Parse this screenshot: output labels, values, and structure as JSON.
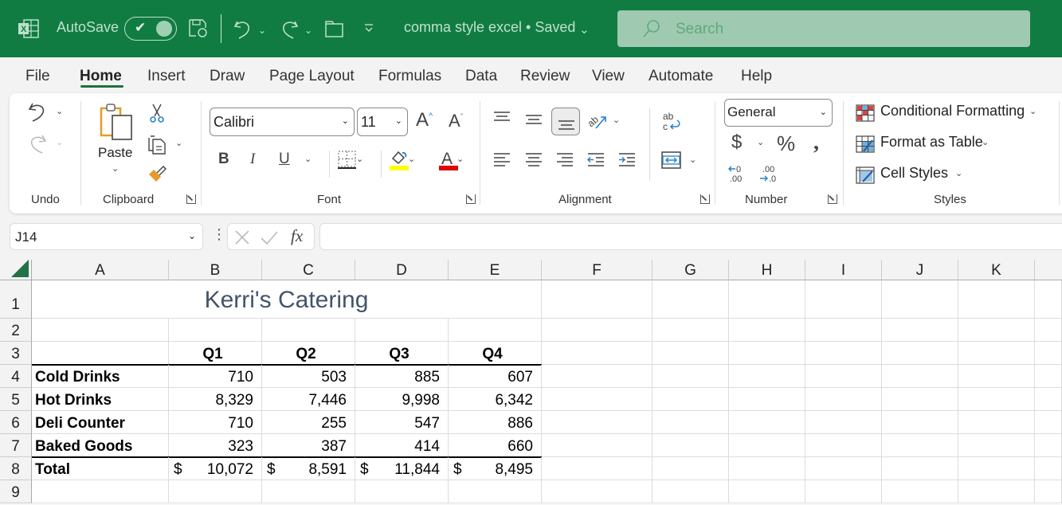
{
  "titlebar": {
    "app_icon": "excel-icon",
    "autosave_label": "AutoSave",
    "autosave_on": true,
    "save_icon": "save-icon",
    "undo_icon": "undo-icon",
    "redo_icon": "redo-icon",
    "open_icon": "folder-icon",
    "customize_icon": "customize-quick-access-icon",
    "document_title": "comma style excel • Saved",
    "search_placeholder": "Search"
  },
  "menu": {
    "tabs": [
      "File",
      "Home",
      "Insert",
      "Draw",
      "Page Layout",
      "Formulas",
      "Data",
      "Review",
      "View",
      "Automate",
      "Help"
    ],
    "active": "Home"
  },
  "ribbon": {
    "groups": {
      "undo": "Undo",
      "clipboard": "Clipboard",
      "font": "Font",
      "alignment": "Alignment",
      "number": "Number",
      "styles": "Styles"
    },
    "paste_label": "Paste",
    "font_name": "Calibri",
    "font_size": "11",
    "number_format": "General",
    "bold": "B",
    "italic": "I",
    "underline": "U",
    "currency_symbol": "$",
    "percent_symbol": "%",
    "comma_symbol": "❟",
    "styles": {
      "conditional_formatting": "Conditional Formatting",
      "format_as_table": "Format as Table",
      "cell_styles": "Cell Styles"
    },
    "colors": {
      "highlight": "#ffff00",
      "font_color": "#e00000"
    }
  },
  "formula_bar": {
    "name_box": "J14",
    "formula": ""
  },
  "sheet": {
    "columns": [
      "A",
      "B",
      "C",
      "D",
      "E",
      "F",
      "G",
      "H",
      "I",
      "J",
      "K"
    ],
    "rows": [
      "1",
      "2",
      "3",
      "4",
      "5",
      "6",
      "7",
      "8",
      "9"
    ],
    "title": "Kerri's Catering",
    "quarter_headers": [
      "Q1",
      "Q2",
      "Q3",
      "Q4"
    ],
    "data_rows": [
      {
        "label": "Cold Drinks",
        "values": [
          "710",
          "503",
          "885",
          "607"
        ]
      },
      {
        "label": "Hot Drinks",
        "values": [
          "8,329",
          "7,446",
          "9,998",
          "6,342"
        ]
      },
      {
        "label": "Deli Counter",
        "values": [
          "710",
          "255",
          "547",
          "886"
        ]
      },
      {
        "label": "Baked Goods",
        "values": [
          "323",
          "387",
          "414",
          "660"
        ]
      }
    ],
    "total_row": {
      "label": "Total",
      "currency": "$",
      "values": [
        "10,072",
        "8,591",
        "11,844",
        "8,495"
      ]
    }
  }
}
